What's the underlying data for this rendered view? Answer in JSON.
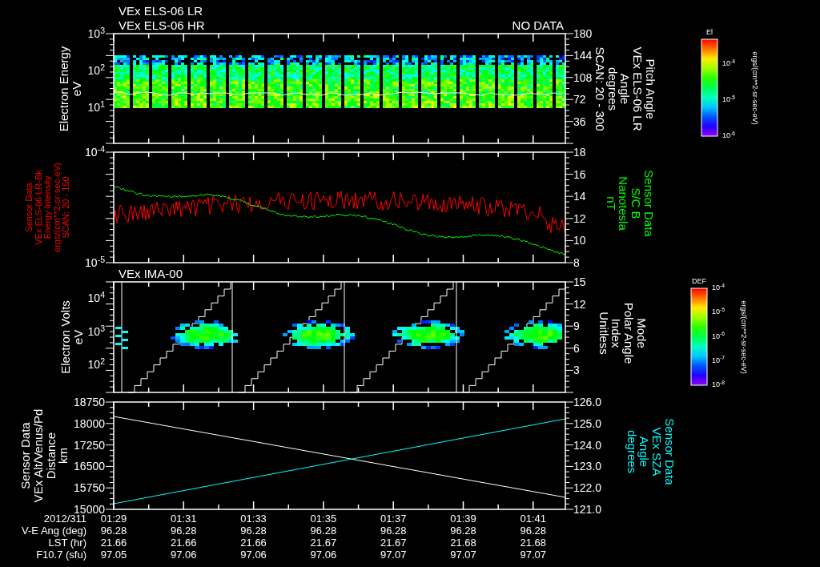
{
  "panels": [
    {
      "kind": "energy_spectrogram",
      "titles": [
        "VEx ELS-06 LR",
        "VEx ELS-06 HR"
      ],
      "status": "NO DATA",
      "left_axis": {
        "color": "#ffffff",
        "title_lines": [
          "Electron Energy",
          "eV"
        ],
        "ticks": [
          "10$^{3}$",
          "10$^{2}$",
          "10$^{1}$"
        ]
      },
      "right_axis": {
        "color": "#ffffff",
        "title_lines": [
          "Pitch Angle",
          "VEx ELS-06 LR",
          "Angle",
          "degrees",
          "SCAN: 20 - 300"
        ],
        "ticks": [
          "180",
          "144",
          "108",
          "72",
          "36"
        ]
      },
      "colorbar": {
        "title": "El",
        "ticks": [
          "10$^{-4}$",
          "10$^{-5}$",
          "10$^{-6}$"
        ],
        "unit": "ergs/(cm**2-sr-sec-eV)"
      }
    },
    {
      "kind": "noisy_lines",
      "left_axis": {
        "color": "#ff0000",
        "title_lines": [
          "Sensor Data",
          "VEx ELS-06 LR-Bk",
          "Energy Intensity",
          "ergs/(cm**2-sr-sec-eV)",
          "SCAN: 20 - 150"
        ],
        "ticks": [
          "10$^{-4}$",
          "10$^{-5}$"
        ]
      },
      "right_axis": {
        "color": "#00ff00",
        "title_lines": [
          "Sensor Data",
          "S/C B",
          "Nanotesla",
          "nT"
        ],
        "ticks": [
          "18",
          "16",
          "14",
          "12",
          "10",
          "8"
        ]
      },
      "traces": [
        {
          "color": "#ff0000"
        },
        {
          "color": "#00ff00"
        }
      ]
    },
    {
      "kind": "ion_spectrogram",
      "titles": [
        "VEx IMA-00"
      ],
      "left_axis": {
        "color": "#ffffff",
        "title_lines": [
          "Electron Volts",
          "eV"
        ],
        "ticks": [
          "10$^{4}$",
          "10$^{3}$",
          "10$^{2}$"
        ]
      },
      "right_axis": {
        "color": "#ffffff",
        "title_lines": [
          "Mode",
          "Polar Angle",
          "Index",
          "Unitless"
        ],
        "ticks": [
          "15",
          "12",
          "9",
          "6",
          "3"
        ]
      },
      "colorbar": {
        "title": "DEF",
        "ticks": [
          "10$^{-4}$",
          "10$^{-5}$",
          "10$^{-6}$",
          "10$^{-7}$",
          "10$^{-8}$"
        ],
        "unit": "ergs/(cm**2-sr-sec-eV)"
      }
    },
    {
      "kind": "straight_lines",
      "left_axis": {
        "color": "#ffffff",
        "title_lines": [
          "Sensor Data",
          "VEx Alt/Venus/Pd",
          "Distance",
          "km"
        ],
        "ticks": [
          "18750",
          "18000",
          "17250",
          "16500",
          "15750",
          "15000"
        ]
      },
      "right_axis": {
        "color": "#00ffff",
        "title_lines": [
          "Sensor Data",
          "VEx SZA",
          "Angle",
          "degrees"
        ],
        "ticks": [
          "126.0",
          "125.0",
          "124.0",
          "123.0",
          "122.0",
          "121.0"
        ]
      },
      "traces": [
        {
          "color": "#ffffff"
        },
        {
          "color": "#00ffff"
        }
      ]
    }
  ],
  "time_axis": [
    {
      "label": "2012/311",
      "values": [
        "01:29",
        "01:31",
        "01:33",
        "01:35",
        "01:37",
        "01:39",
        "01:41"
      ]
    },
    {
      "label": "V-E Ang (deg)",
      "values": [
        "96.28",
        "96.28",
        "96.28",
        "96.28",
        "96.28",
        "96.28",
        "96.28"
      ]
    },
    {
      "label": "LST (hr)",
      "values": [
        "21.66",
        "21.66",
        "21.66",
        "21.67",
        "21.67",
        "21.68",
        "21.68"
      ]
    },
    {
      "label": "F10.7 (sfu)",
      "values": [
        "97.05",
        "97.06",
        "97.06",
        "97.06",
        "97.07",
        "97.07",
        "97.07"
      ]
    }
  ]
}
